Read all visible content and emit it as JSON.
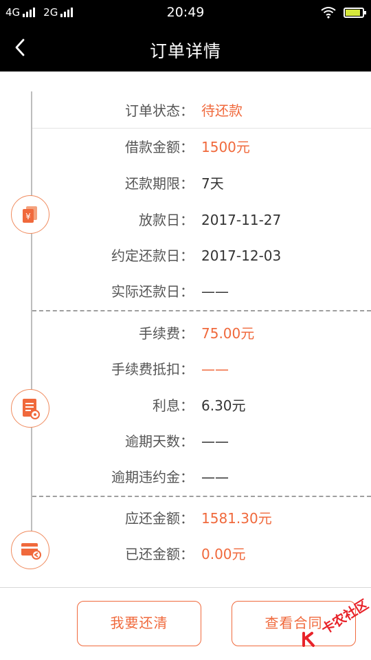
{
  "status_bar": {
    "network_1": "4G",
    "network_2": "2G",
    "time": "20:49"
  },
  "header": {
    "title": "订单详情"
  },
  "section_1": {
    "status": {
      "label": "订单状态：",
      "value": "待还款"
    },
    "rows": [
      {
        "label": "借款金额：",
        "value": "1500元"
      },
      {
        "label": "还款期限：",
        "value": "7天"
      },
      {
        "label": "放款日：",
        "value": "2017-11-27"
      },
      {
        "label": "约定还款日：",
        "value": "2017-12-03"
      },
      {
        "label": "实际还款日：",
        "value": "——"
      }
    ]
  },
  "section_2": {
    "rows": [
      {
        "label": "手续费：",
        "value": "75.00元"
      },
      {
        "label": "手续费抵扣：",
        "value": "——"
      },
      {
        "label": "利息：",
        "value": "6.30元"
      },
      {
        "label": "逾期天数：",
        "value": "——"
      },
      {
        "label": "逾期违约金：",
        "value": "——"
      }
    ]
  },
  "section_3": {
    "rows": [
      {
        "label": "应还金额：",
        "value": "1581.30元"
      },
      {
        "label": "已还金额：",
        "value": "0.00元"
      }
    ]
  },
  "buttons": {
    "repay": "我要还清",
    "contract": "查看合同"
  },
  "watermark": {
    "text": "卡农社区"
  },
  "icons": {
    "section_1": "money-cards-icon",
    "section_2": "fee-document-icon",
    "section_3": "card-refund-icon"
  },
  "colors": {
    "accent": "#f0693c",
    "header_bg": "#000000",
    "battery_fill": "#d6e83c"
  }
}
